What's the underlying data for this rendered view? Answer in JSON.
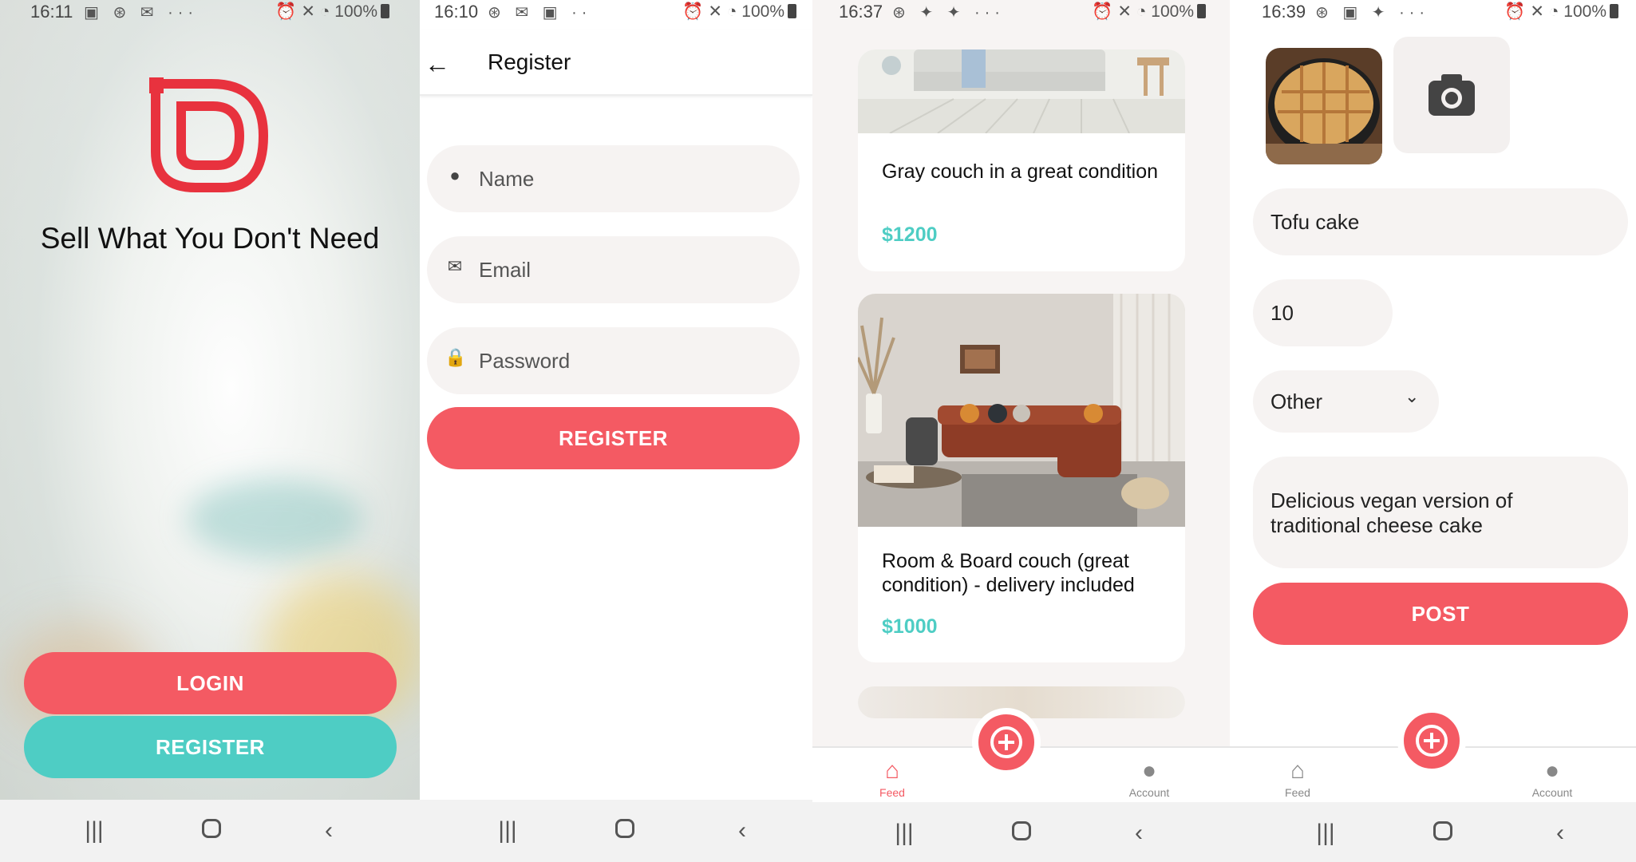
{
  "colors": {
    "accent": "#f45a63",
    "teal": "#4ecdc4",
    "field_bg": "#f6f3f2"
  },
  "screen1": {
    "status": {
      "time": "16:11",
      "battery": "100%"
    },
    "tagline": "Sell What You Don't Need",
    "login_label": "LOGIN",
    "register_label": "REGISTER"
  },
  "screen2": {
    "status": {
      "time": "16:10",
      "battery": "100%"
    },
    "title": "Register",
    "name_placeholder": "Name",
    "email_placeholder": "Email",
    "password_placeholder": "Password",
    "register_label": "REGISTER"
  },
  "screen3": {
    "status": {
      "time": "16:37",
      "battery": "100%"
    },
    "listings": [
      {
        "title": "Gray couch in a great condition",
        "price": "$1200"
      },
      {
        "title": "Room & Board couch (great condition) - delivery included",
        "price": "$1000"
      }
    ],
    "tabs": {
      "feed": "Feed",
      "account": "Account"
    }
  },
  "screen4": {
    "status": {
      "time": "16:39",
      "battery": "100%"
    },
    "title_value": "Tofu cake",
    "quantity_value": "10",
    "category_value": "Other",
    "description_value": "Delicious  vegan version of traditional cheese cake",
    "post_label": "POST",
    "tabs": {
      "feed": "Feed",
      "account": "Account"
    }
  }
}
